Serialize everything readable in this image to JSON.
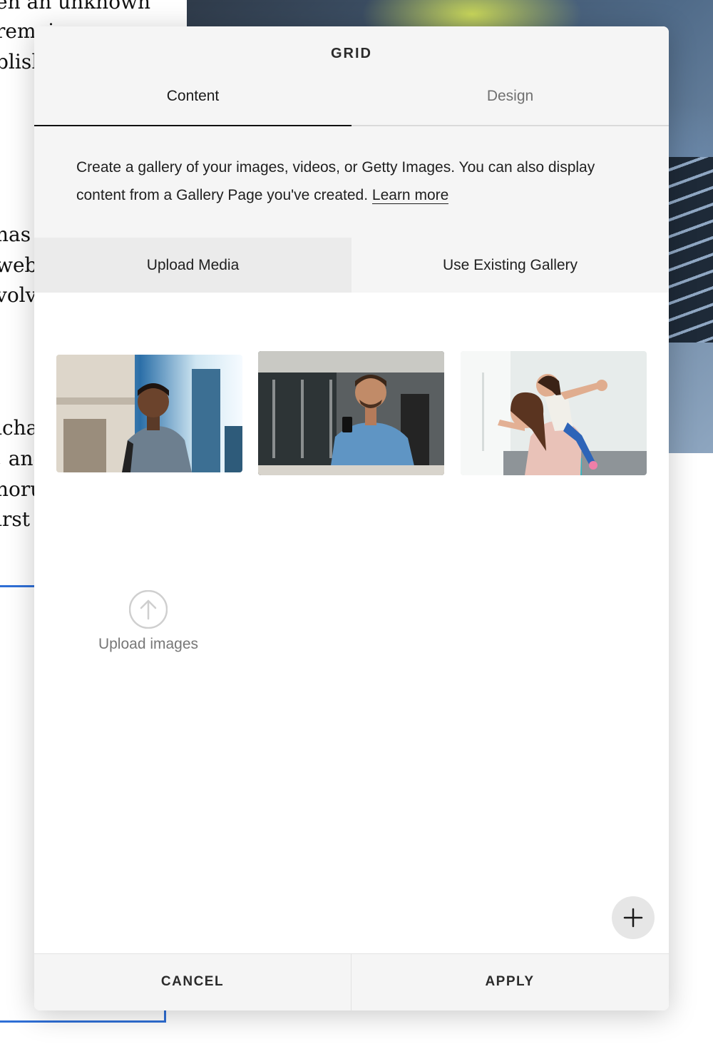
{
  "background": {
    "text_lines": [
      "en an unknown",
      "remai",
      "blish",
      "has a",
      "web",
      "volv",
      "icha",
      ", anc",
      "noru",
      "irst"
    ]
  },
  "modal": {
    "title": "GRID",
    "tabs": [
      {
        "label": "Content",
        "active": true
      },
      {
        "label": "Design",
        "active": false
      }
    ],
    "description": "Create a gallery of your images, videos, or Getty Images. You can also display content from a Gallery Page you've created.",
    "learn_more": "Learn more",
    "segments": [
      {
        "label": "Upload Media",
        "selected": true
      },
      {
        "label": "Use Existing Gallery",
        "selected": false
      }
    ],
    "thumbnails": [
      {
        "subject": "man-with-backpack-outdoors"
      },
      {
        "subject": "man-with-phone-at-desk"
      },
      {
        "subject": "mother-carrying-daughter"
      }
    ],
    "upload_label": "Upload images",
    "footer": {
      "cancel": "CANCEL",
      "apply": "APPLY"
    }
  },
  "colors": {
    "panel_bg": "#f5f5f5",
    "selected_segment": "#ebebeb",
    "accent_blue": "#2f6fd6",
    "text": "#1f1f1f"
  }
}
